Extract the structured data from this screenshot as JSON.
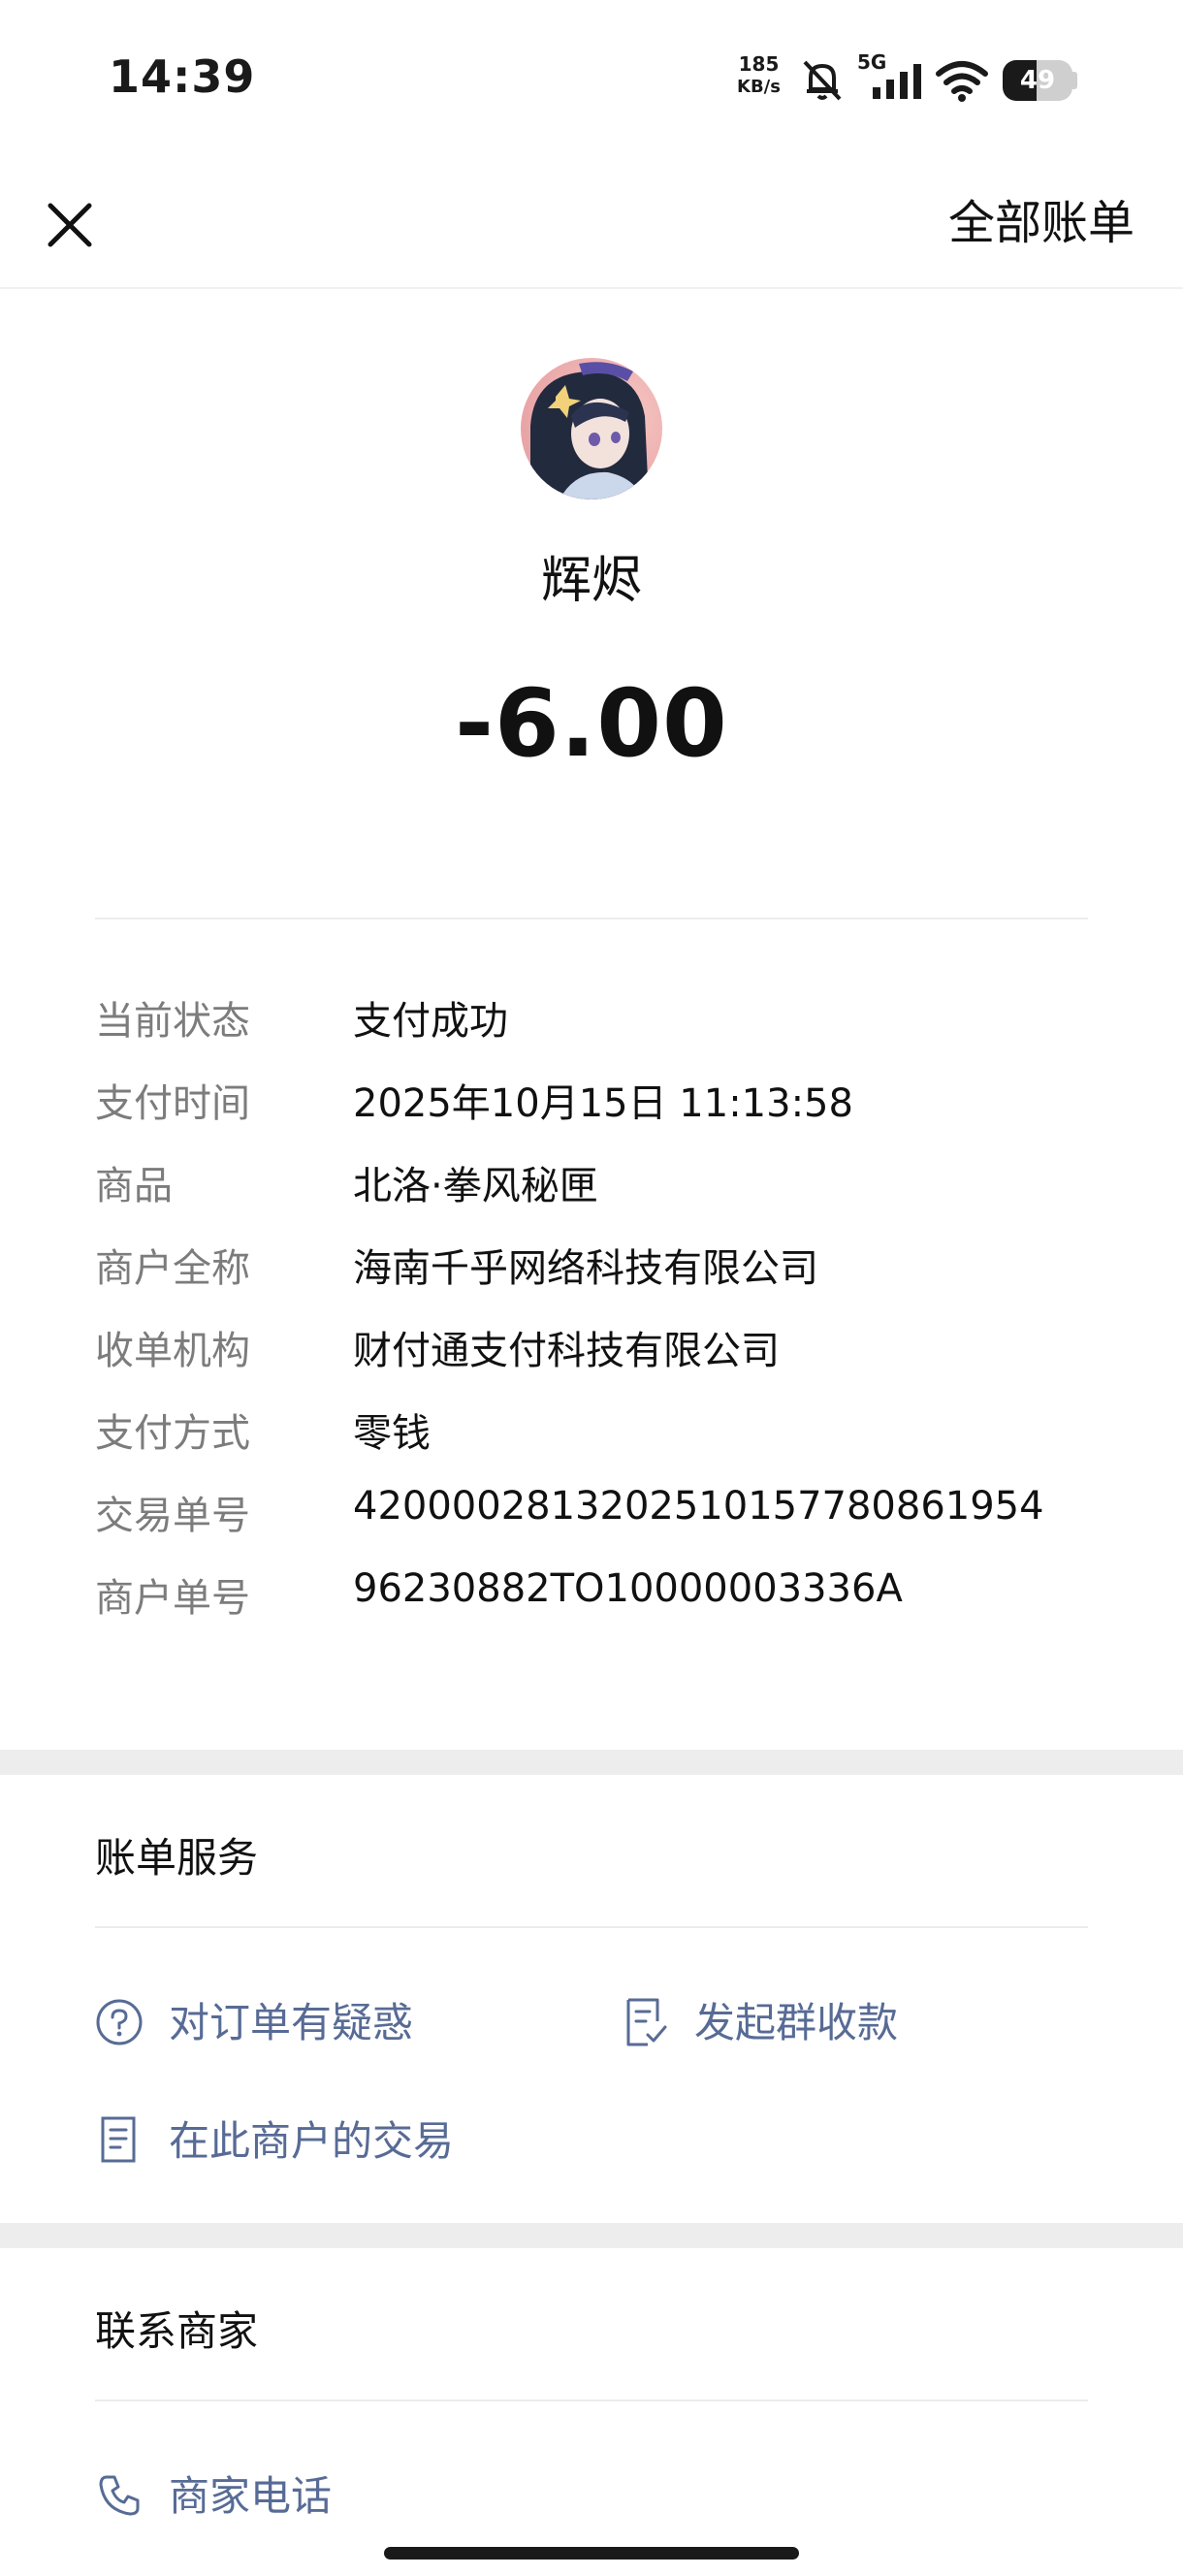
{
  "status_bar": {
    "time": "14:39",
    "net_speed": "185",
    "net_unit": "KB/s",
    "network": "5G",
    "battery": "49",
    "battery_level": 0.49,
    "icons": [
      "mute-bell-icon",
      "signal-icon",
      "wifi-icon",
      "battery-icon"
    ]
  },
  "header": {
    "close_icon": "close-icon",
    "all_bills_label": "全部账单"
  },
  "payee": {
    "name": "辉烬",
    "amount": "-6.00"
  },
  "details": [
    {
      "label": "当前状态",
      "value": "支付成功"
    },
    {
      "label": "支付时间",
      "value": "2025年10月15日 11:13:58"
    },
    {
      "label": "商品",
      "value": "北洛·拳风秘匣"
    },
    {
      "label": "商户全称",
      "value": "海南千乎网络科技有限公司"
    },
    {
      "label": "收单机构",
      "value": "财付通支付科技有限公司"
    },
    {
      "label": "支付方式",
      "value": "零钱"
    },
    {
      "label": "交易单号",
      "value": "4200002813202510157780861954"
    },
    {
      "label": "商户单号",
      "value": "96230882TO10000003336A"
    }
  ],
  "bill_services": {
    "title": "账单服务",
    "items": [
      {
        "label": "对订单有疑惑",
        "icon": "question-circle-icon"
      },
      {
        "label": "发起群收款",
        "icon": "group-collect-icon"
      },
      {
        "label": "在此商户的交易",
        "icon": "document-list-icon"
      }
    ]
  },
  "contact": {
    "title": "联系商家",
    "items": [
      {
        "label": "商家电话",
        "icon": "phone-icon"
      }
    ]
  },
  "colors": {
    "link": "#576b95",
    "label_gray": "#7c7c7c",
    "band": "#ededed"
  }
}
